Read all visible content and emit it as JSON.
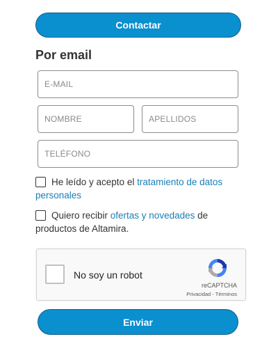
{
  "contact_button": {
    "label": "Contactar"
  },
  "section_heading": "Por email",
  "fields": {
    "email": {
      "placeholder": "E-MAIL",
      "value": ""
    },
    "nombre": {
      "placeholder": "NOMBRE",
      "value": ""
    },
    "apellidos": {
      "placeholder": "APELLIDOS",
      "value": ""
    },
    "telefono": {
      "placeholder": "TELÉFONO",
      "value": ""
    }
  },
  "privacy_check": {
    "checked": false,
    "text_before": "He leído y acepto el ",
    "link_text": "tratamiento de datos personales"
  },
  "offers_check": {
    "checked": false,
    "text_before": "Quiero recibir ",
    "link_text": "ofertas y novedades",
    "text_after": " de productos de Altamira."
  },
  "captcha": {
    "label": "No soy un robot",
    "brand": "reCAPTCHA",
    "links": "Privacidad - Términos",
    "icon": "recaptcha-icon"
  },
  "submit_button": {
    "label": "Enviar"
  },
  "colors": {
    "primary": "#0a8fcf",
    "link": "#1a7fb7",
    "text": "#333333"
  }
}
